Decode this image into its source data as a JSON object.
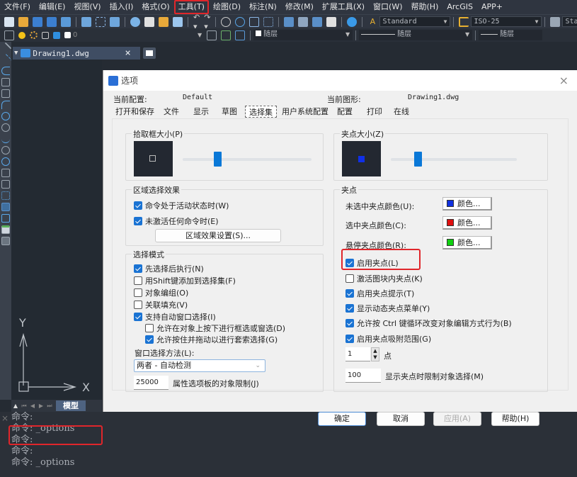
{
  "menubar": {
    "items": [
      "文件(F)",
      "编辑(E)",
      "视图(V)",
      "插入(I)",
      "格式(O)",
      "工具(T)",
      "绘图(D)",
      "标注(N)",
      "修改(M)",
      "扩展工具(X)",
      "窗口(W)",
      "帮助(H)",
      "ArcGIS",
      "APP+"
    ],
    "highlighted": "工具(T)"
  },
  "toolbar": {
    "text_style": "Standard",
    "dim_style": "ISO-25",
    "table_style": "Standa",
    "layer_value": "0",
    "color_value": "随层",
    "linetype_value": "随层",
    "lineweight_value": "随层"
  },
  "doc_tab": {
    "title": "Drawing1.dwg",
    "close": "×"
  },
  "canvas": {
    "ucs_x": "X",
    "ucs_y": "Y",
    "model_tab": "模型"
  },
  "command_lines": [
    "命令:",
    "命令: _options",
    "命令:",
    "命令:",
    "命令: _options"
  ],
  "dialog": {
    "title": "选项",
    "close": "×",
    "current_profile_label": "当前配置:",
    "current_profile_value": "Default",
    "current_drawing_label": "当前图形:",
    "current_drawing_value": "Drawing1.dwg",
    "tabs": [
      "打开和保存",
      "文件",
      "显示",
      "草图",
      "选择集",
      "用户系统配置",
      "配置",
      "打印",
      "在线"
    ],
    "active_tab": "选择集",
    "pickbox": {
      "label": "拾取框大小(P)",
      "slider_fraction": 0.26
    },
    "area_effect": {
      "label": "区域选择效果",
      "options": [
        {
          "label": "命令处于活动状态时(W)",
          "checked": true
        },
        {
          "label": "未激活任何命令时(E)",
          "checked": true
        }
      ],
      "button": "区域效果设置(S)..."
    },
    "select_mode": {
      "label": "选择模式",
      "options": [
        {
          "label": "先选择后执行(N)",
          "checked": true
        },
        {
          "label": "用Shift键添加到选择集(F)",
          "checked": false
        },
        {
          "label": "对象编组(O)",
          "checked": false
        },
        {
          "label": "关联填充(V)",
          "checked": false
        },
        {
          "label": "支持自动窗口选择(I)",
          "checked": true
        },
        {
          "label": "允许在对象上按下进行框选或窗选(D)",
          "checked": false
        },
        {
          "label": "允许按住并拖动以进行套索选择(G)",
          "checked": true
        }
      ],
      "window_method_label": "窗口选择方法(L):",
      "window_method_value": "两者 - 自动检测",
      "object_limit_value": "25000",
      "object_limit_label": "属性选项板的对象限制(J)"
    },
    "grip_size": {
      "label": "夹点大小(Z)",
      "slider_fraction": 0.2
    },
    "grips": {
      "label": "夹点",
      "colors": [
        {
          "label": "未选中夹点颜色(U):",
          "button": "颜色...",
          "swatch": "#1030e0"
        },
        {
          "label": "选中夹点颜色(C):",
          "button": "颜色...",
          "swatch": "#e01010"
        },
        {
          "label": "悬停夹点颜色(R):",
          "button": "颜色...",
          "swatch": "#10d010"
        }
      ],
      "options": [
        {
          "label": "启用夹点(L)",
          "checked": true
        },
        {
          "label": "激活图块内夹点(K)",
          "checked": false
        },
        {
          "label": "启用夹点提示(T)",
          "checked": true
        },
        {
          "label": "显示动态夹点菜单(Y)",
          "checked": true
        },
        {
          "label": "允许按 Ctrl 键循环改变对象编辑方式行为(B)",
          "checked": true
        },
        {
          "label": "启用夹点吸附范围(G)",
          "checked": true
        }
      ],
      "snap_value": "1",
      "snap_unit": "点",
      "limit_value": "100",
      "limit_label": "显示夹点时限制对象选择(M)"
    },
    "buttons": {
      "ok": "确定",
      "cancel": "取消",
      "apply": "应用(A)",
      "help": "帮助(H)"
    }
  }
}
